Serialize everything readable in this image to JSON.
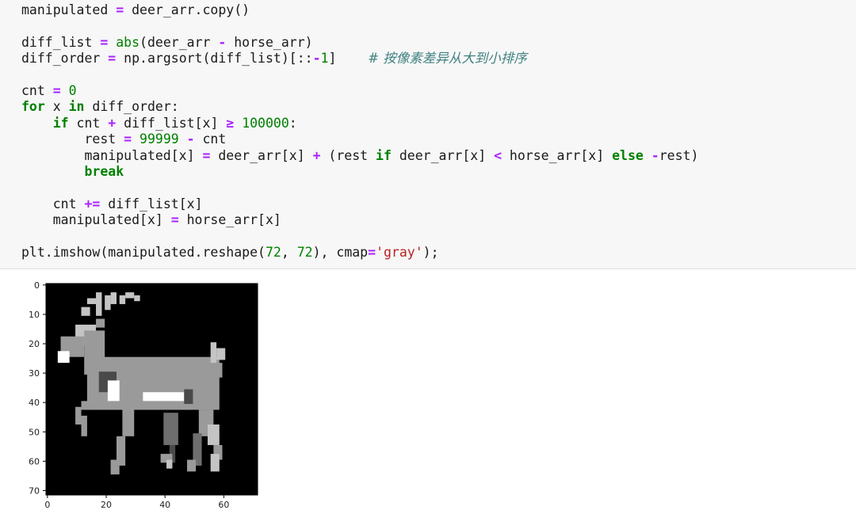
{
  "code_cell": {
    "lines": [
      [
        [
          "",
          "manipulated "
        ],
        [
          "op",
          "="
        ],
        [
          "",
          " deer_arr.copy()"
        ]
      ],
      [],
      [
        [
          "",
          "diff_list "
        ],
        [
          "op",
          "="
        ],
        [
          "",
          " "
        ],
        [
          "fn",
          "abs"
        ],
        [
          "",
          "(deer_arr "
        ],
        [
          "op",
          "-"
        ],
        [
          "",
          " horse_arr)"
        ]
      ],
      [
        [
          "",
          "diff_order "
        ],
        [
          "op",
          "="
        ],
        [
          "",
          " np.argsort(diff_list)[::"
        ],
        [
          "op",
          "-"
        ],
        [
          "num",
          "1"
        ],
        [
          "",
          "]    "
        ],
        [
          "cm",
          "# 按像素差异从大到小排序"
        ]
      ],
      [],
      [
        [
          "",
          "cnt "
        ],
        [
          "op",
          "="
        ],
        [
          "",
          " "
        ],
        [
          "num",
          "0"
        ]
      ],
      [
        [
          "kw",
          "for"
        ],
        [
          "",
          " x "
        ],
        [
          "kw",
          "in"
        ],
        [
          "",
          " diff_order:"
        ]
      ],
      [
        [
          "",
          "    "
        ],
        [
          "kw",
          "if"
        ],
        [
          "",
          " cnt "
        ],
        [
          "op",
          "+"
        ],
        [
          "",
          " diff_list[x] "
        ],
        [
          "op",
          "≥"
        ],
        [
          "",
          " "
        ],
        [
          "num",
          "100000"
        ],
        [
          "",
          ":"
        ]
      ],
      [
        [
          "",
          "        rest "
        ],
        [
          "op",
          "="
        ],
        [
          "",
          " "
        ],
        [
          "num",
          "99999"
        ],
        [
          "",
          " "
        ],
        [
          "op",
          "-"
        ],
        [
          "",
          " cnt"
        ]
      ],
      [
        [
          "",
          "        manipulated[x] "
        ],
        [
          "op",
          "="
        ],
        [
          "",
          " deer_arr[x] "
        ],
        [
          "op",
          "+"
        ],
        [
          "",
          " (rest "
        ],
        [
          "kw",
          "if"
        ],
        [
          "",
          " deer_arr[x] "
        ],
        [
          "op",
          "<"
        ],
        [
          "",
          " horse_arr[x] "
        ],
        [
          "kw",
          "else"
        ],
        [
          "",
          " "
        ],
        [
          "op",
          "-"
        ],
        [
          "",
          "rest)"
        ]
      ],
      [
        [
          "",
          "        "
        ],
        [
          "kw",
          "break"
        ]
      ],
      [],
      [
        [
          "",
          "    cnt "
        ],
        [
          "op",
          "+="
        ],
        [
          "",
          " diff_list[x]"
        ]
      ],
      [
        [
          "",
          "    manipulated[x] "
        ],
        [
          "op",
          "="
        ],
        [
          "",
          " horse_arr[x]"
        ]
      ],
      [],
      [
        [
          "",
          "plt.imshow(manipulated.reshape("
        ],
        [
          "num",
          "72"
        ],
        [
          "",
          ", "
        ],
        [
          "num",
          "72"
        ],
        [
          "",
          "), cmap"
        ],
        [
          "op",
          "="
        ],
        [
          "str",
          "'gray'"
        ],
        [
          "",
          ");"
        ]
      ]
    ]
  },
  "output": {
    "chart_data": {
      "type": "image",
      "xticks": [
        "0",
        "20",
        "40",
        "60"
      ],
      "yticks": [
        "0",
        "10",
        "20",
        "30",
        "40",
        "50",
        "60",
        "70"
      ],
      "xlim": [
        -0.5,
        71.5
      ],
      "ylim": [
        71.5,
        -0.5
      ],
      "cmap": "gray"
    }
  }
}
